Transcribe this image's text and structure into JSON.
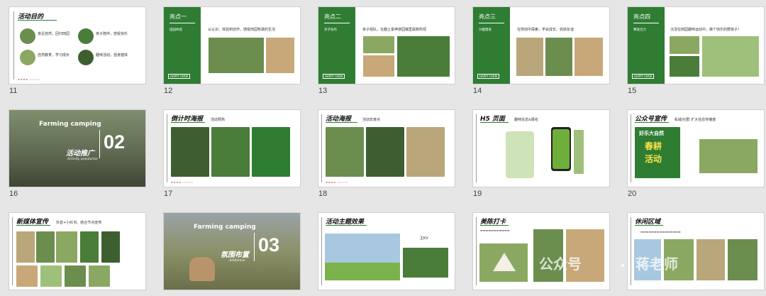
{
  "slides": {
    "s11": {
      "num": "11",
      "title": "活动目的",
      "items": [
        "亲近自然，回归田园",
        "亲子陪伴，感受快乐",
        "自然教育，学习成长",
        "趣味活动，强身健体"
      ]
    },
    "s12": {
      "num": "12",
      "badge": "亮点一",
      "side_sub": "田园体验",
      "caption": "从认识、体验到创作，感受田园牧歌的生活",
      "footer": "HAPPY FARM"
    },
    "s13": {
      "num": "13",
      "badge": "亮点二",
      "side_sub": "亲子协作",
      "caption": "亲子组队，在趣土豪神游园镇里属帐所观",
      "footer": "HAPPY FARM"
    },
    "s14": {
      "num": "14",
      "badge": "亮点三",
      "side_sub": "兴趣激发",
      "caption": "在劳动中探索，学会成长，收获友谊",
      "footer": "HAPPY FARM"
    },
    "s15": {
      "num": "15",
      "badge": "亮点四",
      "side_sub": "释放活力",
      "caption": "沉浸在田园趣味运动中，做个快乐的野孩子！",
      "footer": "HAPPY FARM"
    },
    "s16": {
      "num": "16",
      "farm": "Farming camping",
      "big": "02",
      "cn": "活动推广",
      "en": "Activity popularize"
    },
    "s17": {
      "num": "17",
      "title": "倒计时海报",
      "sub": "活动预热"
    },
    "s18": {
      "num": "18",
      "title": "活动海报",
      "sub": "活动年度点"
    },
    "s19": {
      "num": "19",
      "title": "H5 页面",
      "sub": "趣味信息&报名"
    },
    "s20": {
      "num": "20",
      "title": "公众号宣传",
      "sub": "私域/社群 扩大信息传播度",
      "poster1": "好乐大自然",
      "poster2": "春耕",
      "poster3": "活动"
    },
    "s21": {
      "num": "21",
      "title": "新媒体宣传",
      "sub": "抖音+小红书、结合节点宣传"
    },
    "s22": {
      "num": "22",
      "farm": "Farming camping",
      "big": "03",
      "cn": "氛围布置",
      "en": "Ambience"
    },
    "s23": {
      "num": "23",
      "title": "活动主题效果",
      "kv": "主KV"
    },
    "s24": {
      "num": "24",
      "title": "美陈打卡"
    },
    "s25": {
      "num": "25",
      "title": "休闲区域"
    }
  },
  "watermark": {
    "left": "公众号",
    "right": "蒋老师"
  }
}
